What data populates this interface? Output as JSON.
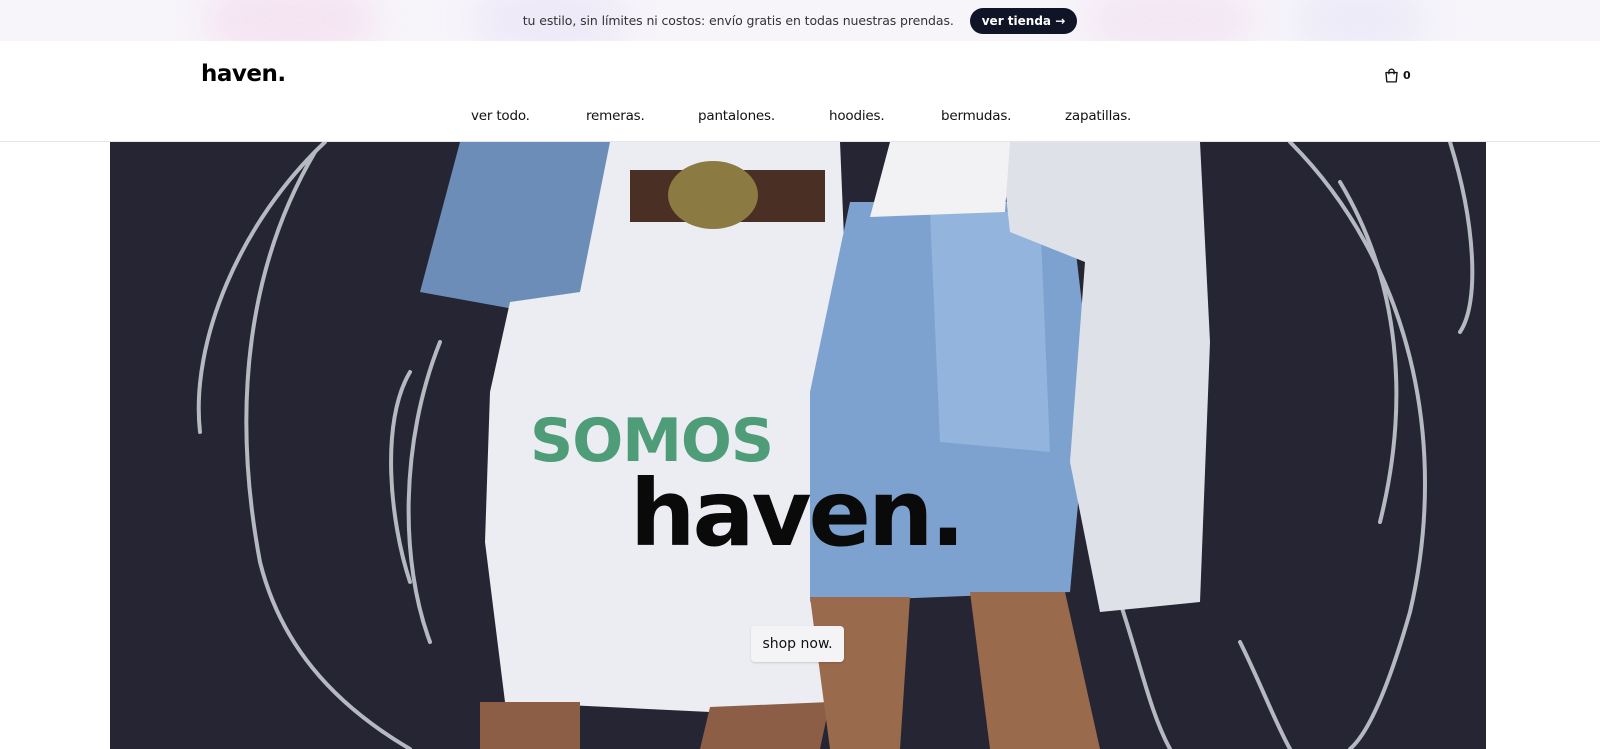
{
  "announcement": {
    "text": "tu estilo, sin límites ni costos: envío gratis en todas nuestras prendas.",
    "button_label": "ver tienda →"
  },
  "header": {
    "logo": "haven.",
    "cart_count": "0",
    "cart_icon": "shopping-bag-icon"
  },
  "nav": {
    "items": [
      {
        "label": "ver todo."
      },
      {
        "label": "remeras."
      },
      {
        "label": "pantalones."
      },
      {
        "label": "hoodies."
      },
      {
        "label": "bermudas."
      },
      {
        "label": "zapatillas."
      }
    ]
  },
  "hero": {
    "title_line_1": "SOMOS",
    "title_line_2": "haven.",
    "cta_label": "shop now.",
    "colors": {
      "accent_green": "#4f9d78",
      "background_dark": "#262533"
    }
  }
}
